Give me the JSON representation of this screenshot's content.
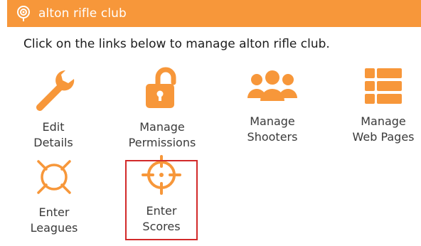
{
  "header": {
    "title": "alton rifle club",
    "icon": "pin-icon",
    "bg_color": "#f7973a"
  },
  "intro_text": "Click on the links below to manage alton rifle club.",
  "accent_color": "#f7973a",
  "selection_color": "#d22a2a",
  "tiles": [
    {
      "line1": "Edit",
      "line2": "Details",
      "icon": "wrench-icon"
    },
    {
      "line1": "Manage",
      "line2": "Permissions",
      "icon": "unlock-icon"
    },
    {
      "line1": "Manage",
      "line2": "Shooters",
      "icon": "users-icon"
    },
    {
      "line1": "Manage",
      "line2": "Web Pages",
      "icon": "list-icon"
    },
    {
      "line1": "Enter",
      "line2": "Leagues",
      "icon": "target-icon"
    },
    {
      "line1": "Enter",
      "line2": "Scores",
      "icon": "crosshair-icon"
    }
  ],
  "selected_tile": "Enter Scores"
}
